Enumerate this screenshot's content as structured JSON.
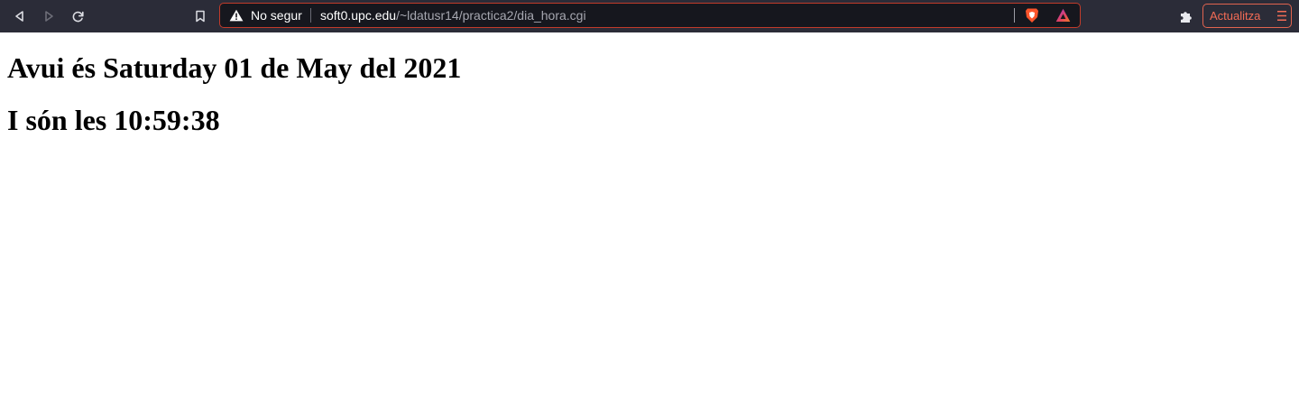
{
  "browser": {
    "nav": {
      "back_icon": "back-arrow-icon",
      "forward_icon": "forward-arrow-icon",
      "reload_icon": "reload-icon",
      "bookmark_icon": "bookmark-icon"
    },
    "address_bar": {
      "security_label": "No segur",
      "security_icon": "warning-triangle-icon",
      "url_host": "soft0.upc.edu",
      "url_path": "/~ldatusr14/practica2/dia_hora.cgi",
      "shield_icon": "brave-shield-icon",
      "rewards_icon": "brave-rewards-icon"
    },
    "extensions_icon": "puzzle-icon",
    "update_button": {
      "label": "Actualitza",
      "icon": "hamburger-menu-icon"
    },
    "colors": {
      "toolbar_bg": "#2b2c38",
      "urlbar_bg": "#16171e",
      "urlbar_border": "#c23b2a",
      "update_accent": "#f26b55"
    }
  },
  "page": {
    "date_line": "Avui és Saturday 01 de May del 2021",
    "time_line": "I són les 10:59:38"
  }
}
